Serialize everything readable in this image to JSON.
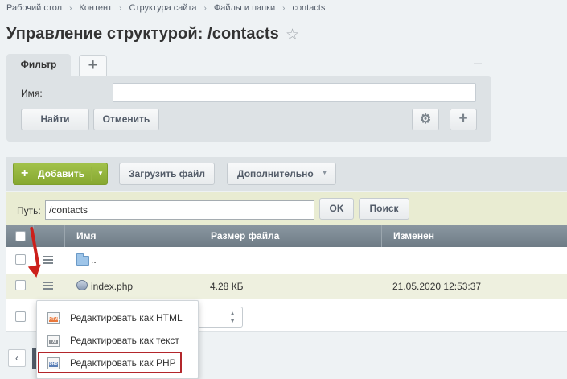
{
  "breadcrumb": [
    "Рабочий стол",
    "Контент",
    "Структура сайта",
    "Файлы и папки",
    "contacts"
  ],
  "title": "Управление структурой: /contacts",
  "filter": {
    "tab_label": "Фильтр",
    "name_label": "Имя:",
    "name_value": "",
    "find_label": "Найти",
    "cancel_label": "Отменить"
  },
  "toolbar": {
    "add_label": "Добавить",
    "upload_label": "Загрузить файл",
    "more_label": "Дополнительно"
  },
  "path": {
    "label": "Путь:",
    "value": "/contacts",
    "ok_label": "OK",
    "search_label": "Поиск"
  },
  "table": {
    "columns": [
      "Имя",
      "Размер файла",
      "Изменен"
    ],
    "rows": [
      {
        "name": "..",
        "size": "",
        "modified": ""
      },
      {
        "name": "index.php",
        "size": "4.28 КБ",
        "modified": "21.05.2020 12:53:37"
      }
    ]
  },
  "context_menu": {
    "items": [
      "Редактировать как HTML",
      "Редактировать как текст",
      "Редактировать как PHP"
    ],
    "highlighted": "Редактировать как PHP"
  },
  "colors": {
    "accent_green": "#8fb03a",
    "header_gray": "#7b8790",
    "highlight_red": "#b3262b",
    "arrow_red": "#cc1f1a"
  }
}
